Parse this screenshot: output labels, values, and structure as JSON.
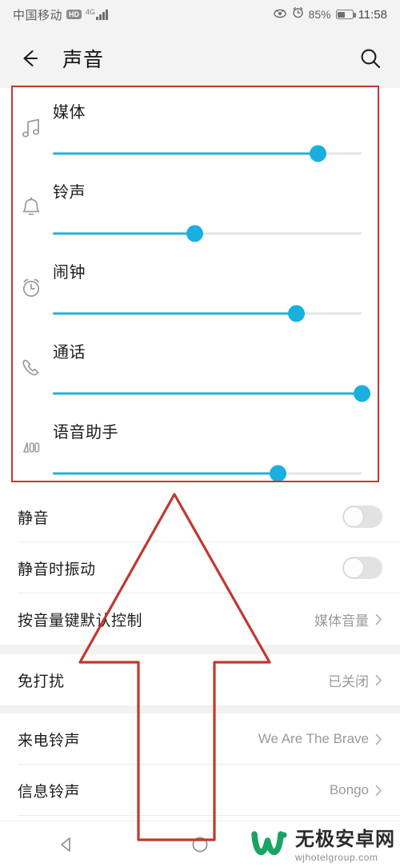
{
  "status_bar": {
    "carrier": "中国移动",
    "hd_badge": "HD",
    "network_type": "4G",
    "eye_icon": "eye-comfort-icon",
    "alarm_icon": "alarm-icon",
    "battery_percent": "85%",
    "time": "11:58"
  },
  "app_bar": {
    "back_icon": "back-arrow-icon",
    "title": "声音",
    "search_icon": "search-icon"
  },
  "volume_sliders": [
    {
      "icon": "music-note-icon",
      "label": "媒体",
      "value": 86
    },
    {
      "icon": "bell-icon",
      "label": "铃声",
      "value": 46
    },
    {
      "icon": "alarm-clock-icon",
      "label": "闹钟",
      "value": 79
    },
    {
      "icon": "phone-handset-icon",
      "label": "通话",
      "value": 100
    },
    {
      "icon": "voice-wave-icon",
      "label": "语音助手",
      "value": 73
    }
  ],
  "toggle_rows": [
    {
      "label": "静音",
      "state": "off"
    },
    {
      "label": "静音时振动",
      "state": "off"
    }
  ],
  "value_rows_group1": [
    {
      "label": "按音量键默认控制",
      "value": "媒体音量",
      "chevron": "chevron-right-icon"
    }
  ],
  "value_rows_group2": [
    {
      "label": "免打扰",
      "value": "已关闭",
      "chevron": "chevron-right-icon"
    }
  ],
  "value_rows_group3": [
    {
      "label": "来电铃声",
      "value": "We Are The Brave",
      "chevron": "chevron-right-icon"
    },
    {
      "label": "信息铃声",
      "value": "Bongo",
      "chevron": "chevron-right-icon"
    }
  ],
  "nav_bar": {
    "back_icon": "nav-back-triangle-icon",
    "home_icon": "nav-home-circle-icon"
  },
  "watermark": {
    "logo_icon": "w-logo-icon",
    "site_name": "无极安卓网",
    "site_url": "wjhotelgroup.com",
    "logo_color": "#19a463"
  },
  "annotations": {
    "highlight_box_color": "#c0392f",
    "arrow_color": "#c0392f"
  }
}
